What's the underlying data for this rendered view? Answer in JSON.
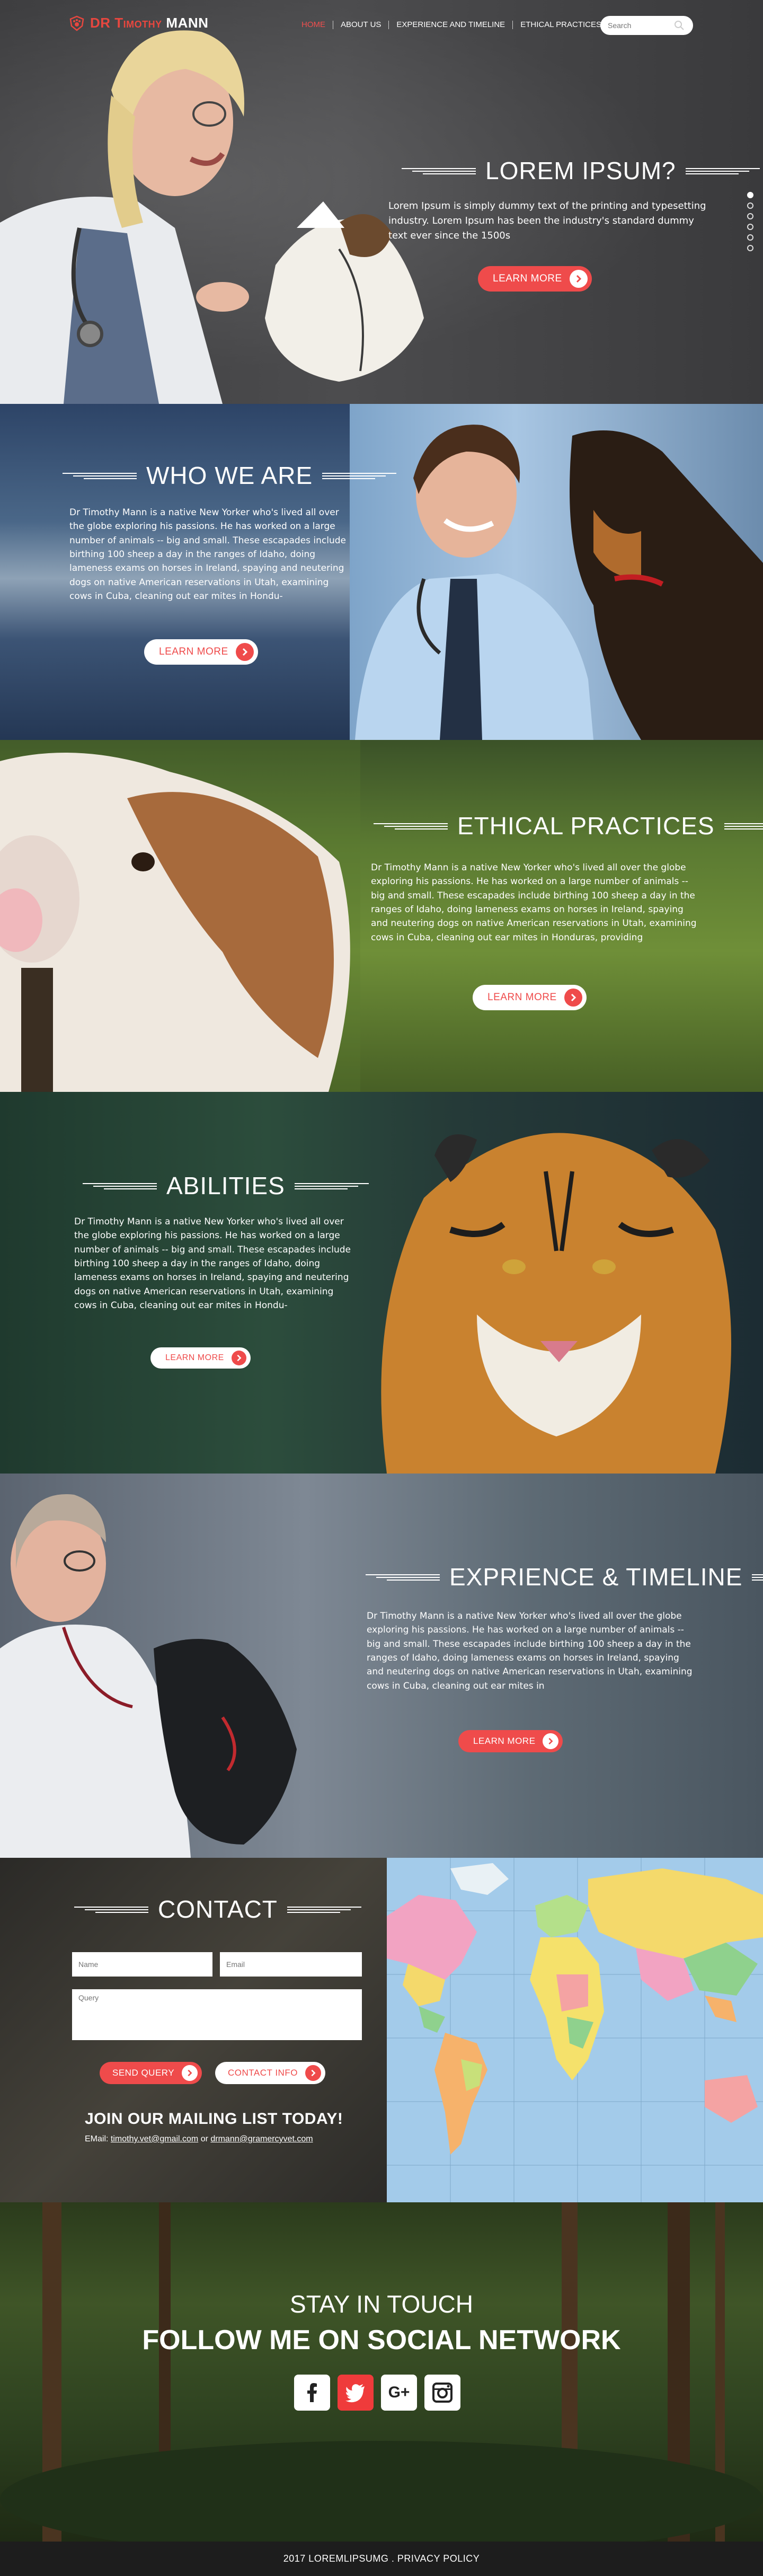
{
  "brand": {
    "dr": "DR",
    "first": "Timothy",
    "last": "MANN"
  },
  "nav": {
    "items": [
      {
        "label": "HOME",
        "active": true
      },
      {
        "label": "ABOUT US"
      },
      {
        "label": "EXPERIENCE AND TIMELINE"
      },
      {
        "label": "ETHICAL PRACTICES"
      }
    ],
    "search_placeholder": "Search"
  },
  "hero": {
    "title": "LOREM IPSUM?",
    "text": "Lorem Ipsum is simply dummy text of the printing and typesetting industry. Lorem Ipsum has been the industry's standard dummy text ever since the 1500s",
    "button": "LEARN MORE"
  },
  "who": {
    "title": "WHO WE ARE",
    "text": "Dr Timothy Mann is a native New Yorker who's lived all over the globe exploring his passions.  He has worked on a large number of animals -- big and small. These escapades include birthing 100 sheep a day in the ranges of Idaho, doing lameness exams on horses in Ireland, spaying and neutering dogs on native American reservations in Utah, examining cows in Cuba, cleaning out ear mites in Hondu-",
    "button": "LEARN MORE"
  },
  "ethical": {
    "title": "ETHICAL PRACTICES",
    "text": "Dr Timothy Mann is a native New Yorker who's lived all over the globe exploring his passions.  He has worked on a large number of animals -- big and small. These escapades include birthing 100 sheep a day in the ranges of Idaho, doing lameness exams on horses in Ireland, spaying and neutering dogs on native American reservations in Utah, examining cows in Cuba, cleaning out ear mites in Honduras, providing",
    "button": "LEARN MORE"
  },
  "abilities": {
    "title": "ABILITIES",
    "text": "Dr Timothy Mann is a native New Yorker who's lived all over the globe exploring his passions.  He has worked on a large number of animals -- big and small. These escapades include birthing 100 sheep a day in the ranges of Idaho, doing lameness exams on horses in Ireland, spaying and neutering dogs on native American reservations in Utah, examining cows in Cuba, cleaning out ear mites in Hondu-",
    "button": "LEARN MORE"
  },
  "experience": {
    "title": "EXPRIENCE & TIMELINE",
    "text": "Dr Timothy Mann is a native New Yorker who's lived all over the globe exploring his passions.  He has worked on a large number of animals -- big and small. These escapades include birthing 100 sheep a day in the ranges of Idaho, doing lameness exams on horses in Ireland, spaying and neutering dogs on native American reservations in Utah, examining cows in Cuba, cleaning out ear mites in",
    "button": "LEARN MORE"
  },
  "contact": {
    "title": "CONTACT",
    "name_placeholder": "Name",
    "email_placeholder": "Email",
    "query_placeholder": "Query",
    "send_button": "SEND QUERY",
    "info_button": "CONTACT INFO",
    "mailing_title": "JOIN OUR MAILING LIST TODAY!",
    "email_label": "EMail:",
    "email_1": "timothy.vet@gmail.com",
    "email_or": "or",
    "email_2": "drmann@gramercyvet.com"
  },
  "social": {
    "line1": "STAY  IN TOUCH",
    "line2": "FOLLOW ME ON SOCIAL NETWORK",
    "icons": [
      "facebook-icon",
      "twitter-icon",
      "google-plus-icon",
      "instagram-icon"
    ]
  },
  "footer": {
    "text": "2017 LOREMLIPSUMG . PRIVACY POLICY"
  },
  "colors": {
    "accent": "#ef4b4b"
  }
}
